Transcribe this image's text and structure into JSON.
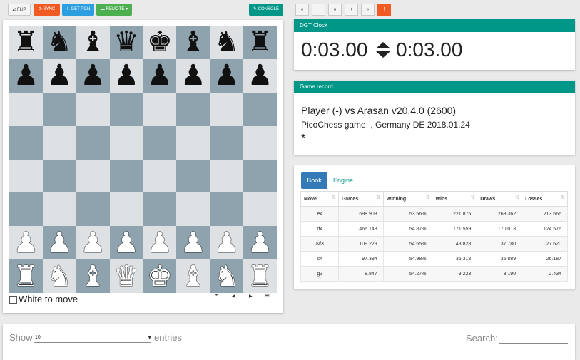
{
  "toolbar": {
    "flip": "⇄ FLIP",
    "sync": "⟳ SYNC",
    "getpgn": "⬇ GET PGN",
    "remote": "☁ REMOTE ▾",
    "console": "✎ CONSOLE"
  },
  "nav": [
    "«",
    "−",
    "⏸",
    "+",
    "»",
    "!"
  ],
  "board": {
    "squares": [
      "♜",
      "♞",
      "♝",
      "♛",
      "♚",
      "♝",
      "♞",
      "♜",
      "♟",
      "♟",
      "♟",
      "♟",
      "♟",
      "♟",
      "♟",
      "♟",
      "",
      "",
      "",
      "",
      "",
      "",
      "",
      "",
      "",
      "",
      "",
      "",
      "",
      "",
      "",
      "",
      "",
      "",
      "",
      "",
      "",
      "",
      "",
      "",
      "",
      "",
      "",
      "",
      "",
      "",
      "",
      "",
      "♙",
      "♙",
      "♙",
      "♙",
      "♙",
      "♙",
      "♙",
      "♙",
      "♖",
      "♘",
      "♗",
      "♕",
      "♔",
      "♗",
      "♘",
      "♖"
    ],
    "side_label": "White to move",
    "nav": [
      "⏮",
      "◀",
      "▶",
      "⏭"
    ]
  },
  "clock": {
    "header": "DGT Clock",
    "left": "0:03.00",
    "right": "0:03.00"
  },
  "game": {
    "header": "Game record",
    "line1": "Player (-) vs Arasan v20.4.0 (2600)",
    "line2": "PicoChess game, , Germany DE 2018.01.24",
    "line3": "*"
  },
  "book": {
    "tab_book": "Book",
    "tab_engine": "Engine",
    "columns": [
      "Move",
      "Games",
      "Winning",
      "Wins",
      "Draws",
      "Losses"
    ],
    "rows": [
      [
        "e4",
        "698.903",
        "53.56%",
        "221.875",
        "263.362",
        "213.666"
      ],
      [
        "d4",
        "466.148",
        "54.87%",
        "171.559",
        "170.013",
        "124.576"
      ],
      [
        "Nf3",
        "109.229",
        "54.65%",
        "43.828",
        "37.780",
        "27.620"
      ],
      [
        "c4",
        "97.394",
        "54.98%",
        "35.318",
        "35.889",
        "26.187"
      ],
      [
        "g3",
        "8.847",
        "54.27%",
        "3.223",
        "3.190",
        "2.434"
      ]
    ]
  },
  "games_list": {
    "show_label": "Show",
    "entries_value": "10",
    "entries_label": "entries",
    "search_label": "Search:"
  },
  "colors": {
    "teal": "#009688",
    "orange": "#f15a22",
    "blue": "#2d9ee0",
    "green": "#4caf50",
    "board_light": "#dde1e4",
    "board_dark": "#8fa3ae"
  }
}
